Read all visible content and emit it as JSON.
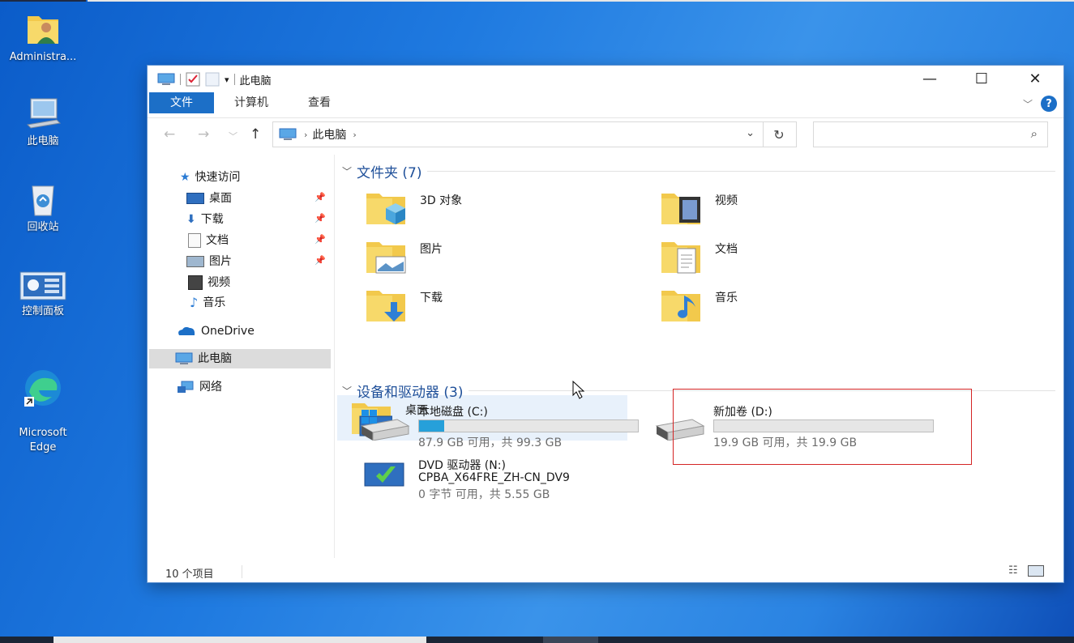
{
  "desktop": {
    "icons": [
      {
        "label": "Administra..."
      },
      {
        "label": "此电脑"
      },
      {
        "label": "回收站"
      },
      {
        "label": "控制面板"
      },
      {
        "label": "Microsoft\nEdge"
      }
    ]
  },
  "window": {
    "title": "此电脑",
    "tabs": [
      "文件",
      "计算机",
      "查看"
    ],
    "address": {
      "crumb": "此电脑"
    },
    "search": {
      "placeholder": ""
    }
  },
  "nav_pane": {
    "quick_access": "快速访问",
    "items": [
      "桌面",
      "下载",
      "文档",
      "图片",
      "视频",
      "音乐"
    ],
    "onedrive": "OneDrive",
    "this_pc": "此电脑",
    "network": "网络"
  },
  "folders": {
    "header": "文件夹 (7)",
    "items": [
      "3D 对象",
      "视频",
      "图片",
      "文档",
      "下载",
      "音乐",
      "桌面"
    ]
  },
  "drives": {
    "header": "设备和驱动器 (3)",
    "items": [
      {
        "name": "本地磁盘 (C:)",
        "free": "87.9 GB 可用，共 99.3 GB",
        "used_fraction": 0.115
      },
      {
        "name": "新加卷 (D:)",
        "free": "19.9 GB 可用，共 19.9 GB",
        "used_fraction": 0.0
      },
      {
        "name": "DVD 驱动器 (N:)",
        "label": "CPBA_X64FRE_ZH-CN_DV9",
        "free": "0 字节 可用，共 5.55 GB"
      }
    ]
  },
  "status": {
    "count": "10 个项目"
  }
}
